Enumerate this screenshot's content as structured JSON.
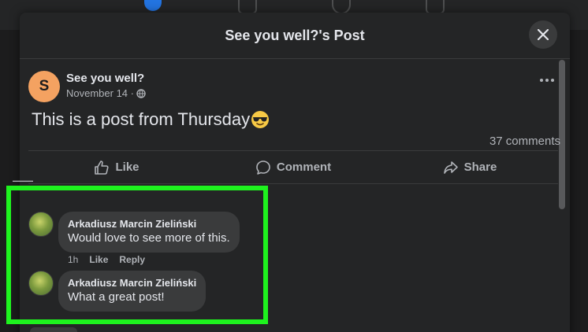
{
  "modal": {
    "title": "See you well?'s Post"
  },
  "post": {
    "author_initial": "S",
    "author_name": "See you well?",
    "date": "November 14 ·",
    "text": "This is a post from Thursday",
    "comment_count": "37 comments"
  },
  "actions": {
    "like": "Like",
    "comment": "Comment",
    "share": "Share"
  },
  "comments": [
    {
      "author": "Arkadiusz Marcin Zieliński",
      "text": "Would love to see more of this.",
      "time": "1h",
      "like": "Like",
      "reply": "Reply"
    },
    {
      "author": "Arkadiusz Marcin Zieliński",
      "text": "What a great post!"
    }
  ],
  "colors": {
    "highlight": "#1ef21e",
    "avatar_bg": "#f4a261",
    "modal_bg": "#242526",
    "bubble_bg": "#3a3b3c"
  }
}
